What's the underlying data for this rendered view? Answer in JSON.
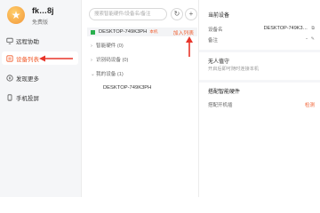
{
  "profile": {
    "name": "fk…8j",
    "level": "免费版",
    "avatar_icon": "star-icon"
  },
  "sidebar": {
    "items": [
      {
        "label": "远程协助",
        "icon": "monitor-icon"
      },
      {
        "label": "设备列表",
        "icon": "device-list-icon",
        "active": true
      },
      {
        "label": "发现更多",
        "icon": "discover-icon"
      },
      {
        "label": "手机投屏",
        "icon": "phone-icon"
      }
    ]
  },
  "device_list": {
    "search_placeholder": "搜索智能硬件/设备名/备注",
    "refresh_icon": "refresh-icon",
    "add_icon": "plus-icon",
    "current": {
      "name": "DESKTOP-749K3PH",
      "tag": "本机",
      "action": "加入列表"
    },
    "groups": [
      {
        "label": "智能硬件 (0)",
        "icon": "chevron-right-icon"
      },
      {
        "label": "识别码设备 (0)",
        "icon": "chevron-right-icon"
      },
      {
        "label": "我的设备 (1)",
        "icon": "chevron-down-icon"
      }
    ],
    "my_devices": [
      "DESKTOP-749K3PH"
    ]
  },
  "details": {
    "current_title": "当前设备",
    "device_name_label": "设备名",
    "device_name_value": "DESKTOP-749K3…",
    "note_label": "备注",
    "note_value": "-",
    "unattended_title": "无人值守",
    "unattended_desc": "开启后即可随时连接本机",
    "smart_title": "搭配智能硬件",
    "smart_label": "搭配开机插",
    "smart_action": "检测"
  },
  "colors": {
    "accent": "#f05a2a",
    "online": "#2ab04e",
    "sidebar_bg": "#f5f6f8"
  }
}
